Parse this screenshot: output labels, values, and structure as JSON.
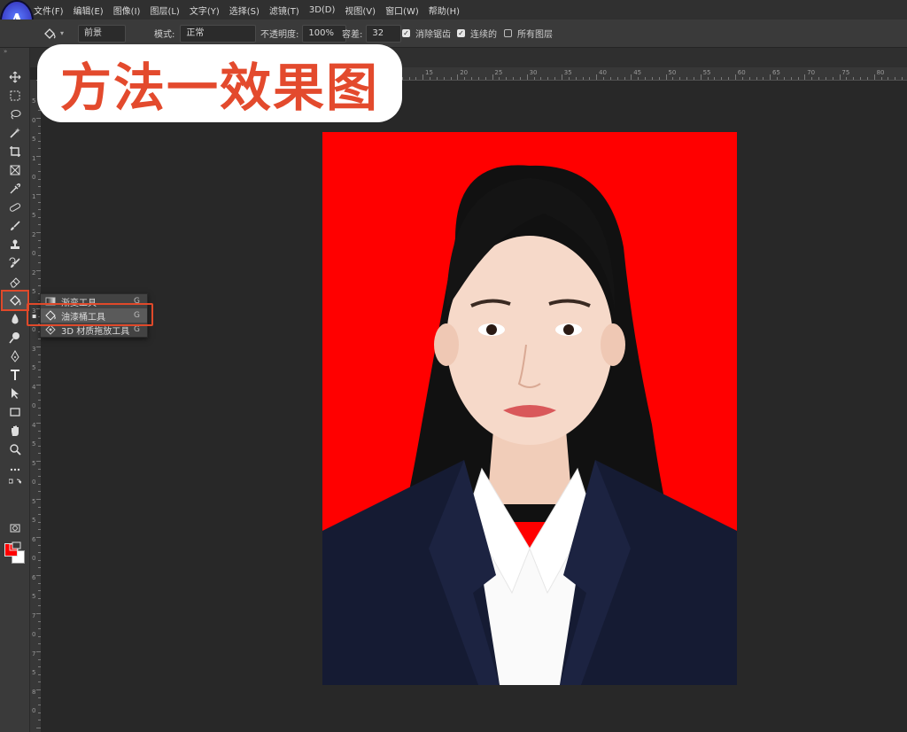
{
  "overlay": {
    "title": "方法一效果图"
  },
  "logo": {
    "letter": "A"
  },
  "menu": [
    "文件(F)",
    "编辑(E)",
    "图像(I)",
    "图层(L)",
    "文字(Y)",
    "选择(S)",
    "滤镜(T)",
    "3D(D)",
    "视图(V)",
    "窗口(W)",
    "帮助(H)"
  ],
  "options": {
    "source_label": "前景",
    "mode_label": "模式:",
    "mode_value": "正常",
    "opacity_label": "不透明度:",
    "opacity_value": "100%",
    "tolerance_label": "容差:",
    "tolerance_value": "32",
    "antialias_label": "消除锯齿",
    "antialias_checked": true,
    "contiguous_label": "连续的",
    "contiguous_checked": true,
    "all_layers_label": "所有图层",
    "all_layers_checked": false
  },
  "ruler": {
    "top_labels": [
      "15",
      "20",
      "25",
      "30",
      "35",
      "40",
      "45",
      "50",
      "55",
      "60",
      "65",
      "70",
      "75",
      "80",
      "85",
      "90"
    ],
    "left_labels": [
      "5",
      "0",
      "5",
      "1",
      "0",
      "1",
      "5",
      "2",
      "0",
      "2",
      "5",
      "3",
      "0",
      "3",
      "5",
      "4",
      "0",
      "4",
      "5",
      "5",
      "0",
      "5",
      "5",
      "6",
      "0",
      "6",
      "5",
      "7",
      "0",
      "7",
      "5",
      "8",
      "0"
    ]
  },
  "flyout": {
    "items": [
      {
        "label": "渐变工具",
        "key": "G",
        "selected": false
      },
      {
        "label": "油漆桶工具",
        "key": "G",
        "selected": true
      },
      {
        "label": "3D 材质拖放工具",
        "key": "G",
        "selected": false
      }
    ]
  },
  "colors": {
    "foreground": "#ff0000",
    "background": "#ffffff",
    "photo_background": "#ff0000",
    "highlight": "#e0492a"
  },
  "icons": [
    "move-icon",
    "marquee-icon",
    "lasso-icon",
    "magic-wand-icon",
    "crop-icon",
    "frame-icon",
    "eyedropper-icon",
    "healing-icon",
    "brush-icon",
    "stamp-icon",
    "history-brush-icon",
    "eraser-icon",
    "paint-bucket-icon",
    "blur-icon",
    "dodge-icon",
    "pen-icon",
    "type-icon",
    "path-select-icon",
    "rectangle-icon",
    "hand-icon",
    "zoom-icon",
    "more-icon",
    "swap-colors-icon",
    "quick-mask-icon",
    "screen-mode-icon"
  ]
}
